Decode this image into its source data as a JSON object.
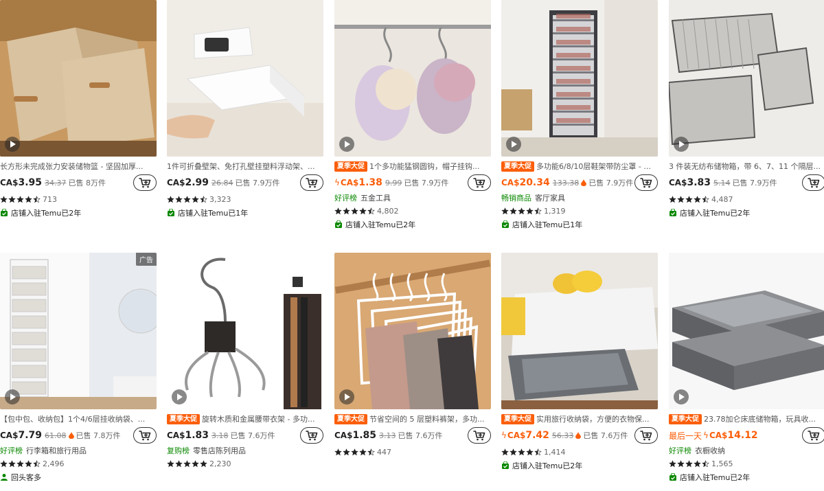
{
  "colors": {
    "accent": "#fb5e0a",
    "green": "#0a8800",
    "star": "#222222"
  },
  "products": [
    {
      "title": "长方形未完成张力安装储物篮 - 坚固加厚...",
      "promo": "",
      "price_prefix": "CA$",
      "price_main": "3.95",
      "was": "34.37",
      "sold": "已售 8万件",
      "flash": false,
      "drop": false,
      "last_day": "",
      "tag_label": "",
      "tag_text": "",
      "rating": 4.5,
      "reviews": "713",
      "store": "店铺入驻Temu已2年",
      "ad": "",
      "video": true,
      "scene": "baskets"
    },
    {
      "title": "1件可折叠壁架、免打孔壁挂塑料浮动架、...",
      "promo": "",
      "price_prefix": "CA$",
      "price_main": "2.99",
      "was": "26.84",
      "sold": "已售 7.9万件",
      "flash": false,
      "drop": false,
      "last_day": "",
      "tag_label": "",
      "tag_text": "",
      "rating": 4.5,
      "reviews": "3,323",
      "store": "店铺入驻Temu已1年",
      "ad": "",
      "video": false,
      "scene": "shelf"
    },
    {
      "title": "1个多功能猛钢圆钩，帽子挂钩...",
      "promo": "夏季大促",
      "price_prefix": "CA$",
      "price_main": "1.38",
      "was": "9.99",
      "sold": "已售 7.9万件",
      "flash": true,
      "drop": false,
      "last_day": "",
      "tag_label": "好评榜",
      "tag_text": "五金工具",
      "rating": 4.5,
      "reviews": "4,802",
      "store": "店铺入驻Temu已2年",
      "ad": "",
      "video": true,
      "scene": "hats"
    },
    {
      "title": "多功能6/8/10层鞋架带防尘罩 - ...",
      "promo": "夏季大促",
      "price_prefix": "CA$",
      "price_main": "20.34",
      "was": "133.38",
      "sold": "已售 7.9万件",
      "flash": false,
      "drop": true,
      "last_day": "",
      "tag_label": "畅销商品",
      "tag_text": "客厅家具",
      "rating": 4.5,
      "reviews": "1,319",
      "store": "店铺入驻Temu已1年",
      "ad": "",
      "video": true,
      "scene": "shoerack"
    },
    {
      "title": "3 件装无纺布储物箱，带 6、7、11 个隔层...",
      "promo": "",
      "price_prefix": "CA$",
      "price_main": "3.83",
      "was": "5.14",
      "sold": "已售 7.9万件",
      "flash": false,
      "drop": false,
      "last_day": "",
      "tag_label": "",
      "tag_text": "",
      "rating": 4.5,
      "reviews": "4,487",
      "store": "店铺入驻Temu已2年",
      "ad": "",
      "video": true,
      "scene": "organizer"
    },
    {
      "title": "【包中包、收纳包】1个4/6层挂收纳袋、...",
      "promo": "",
      "price_prefix": "CA$",
      "price_main": "7.79",
      "was": "61.08",
      "sold": "已售 7.8万件",
      "flash": false,
      "drop": true,
      "last_day": "",
      "tag_label": "好评榜",
      "tag_text": "行李箱和旅行用品",
      "rating": 4.5,
      "reviews": "2,496",
      "store": "回头客多",
      "ad": "广告",
      "video": true,
      "scene": "door"
    },
    {
      "title": "旋转木质和金属腰带衣架 - 多功...",
      "promo": "夏季大促",
      "price_prefix": "CA$",
      "price_main": "1.83",
      "was": "3.18",
      "sold": "已售 7.6万件",
      "flash": false,
      "drop": false,
      "last_day": "",
      "tag_label": "复购榜",
      "tag_text": "零售店陈列用品",
      "rating": 5,
      "reviews": "2,230",
      "store": "",
      "ad": "",
      "video": true,
      "scene": "belt"
    },
    {
      "title": "节省空间的 5 层塑料裤架，多功...",
      "promo": "夏季大促",
      "price_prefix": "CA$",
      "price_main": "1.85",
      "was": "3.13",
      "sold": "已售 7.6万件",
      "flash": false,
      "drop": false,
      "last_day": "",
      "tag_label": "",
      "tag_text": "",
      "rating": 4.5,
      "reviews": "447",
      "store": "",
      "ad": "",
      "video": true,
      "scene": "pants"
    },
    {
      "title": "实用旅行收纳袋，方便的衣物保...",
      "promo": "夏季大促",
      "price_prefix": "CA$",
      "price_main": "7.42",
      "was": "56.33",
      "sold": "已售 7.6万件",
      "flash": true,
      "drop": true,
      "last_day": "",
      "tag_label": "",
      "tag_text": "",
      "rating": 4.5,
      "reviews": "1,414",
      "store": "店铺入驻Temu已2年",
      "ad": "",
      "video": false,
      "scene": "bed"
    },
    {
      "title": "23.78加仑床底储物箱，玩具收...",
      "promo": "夏季大促",
      "price_prefix": "CA$",
      "price_main": "14.12",
      "was": "",
      "sold": "",
      "flash": true,
      "drop": false,
      "last_day": "最后一天",
      "tag_label": "好评榜",
      "tag_text": "衣橱收纳",
      "rating": 4.5,
      "reviews": "1,565",
      "store": "店铺入驻Temu已2年",
      "ad": "",
      "video": true,
      "scene": "underbed"
    }
  ]
}
